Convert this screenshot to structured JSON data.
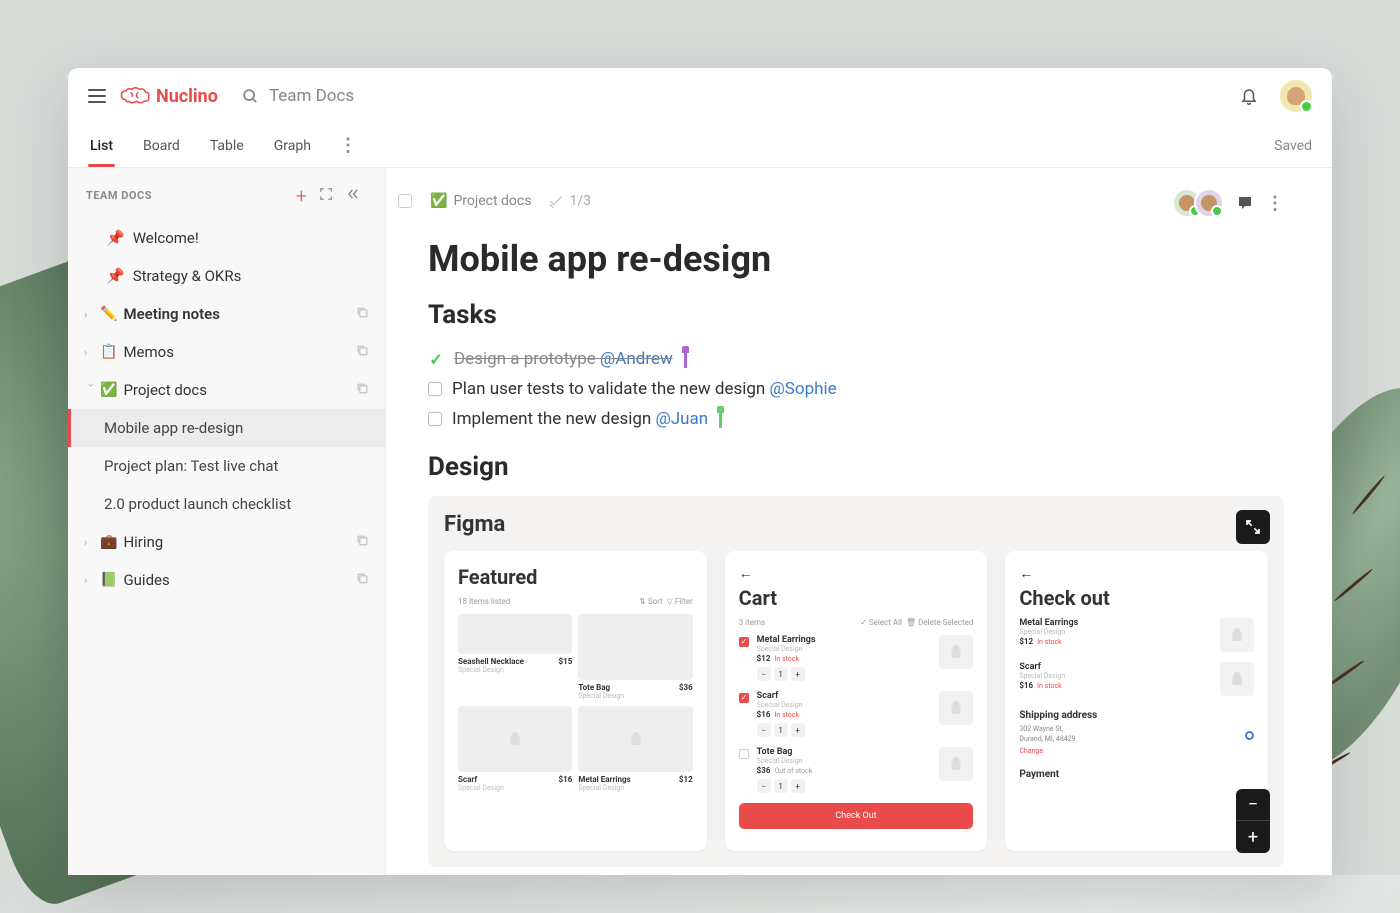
{
  "app_name": "Nuclino",
  "search_placeholder": "Team Docs",
  "saved_label": "Saved",
  "view_tabs": [
    "List",
    "Board",
    "Table",
    "Graph"
  ],
  "sidebar": {
    "title": "TEAM DOCS",
    "pinned": [
      "Welcome!",
      "Strategy & OKRs"
    ],
    "folders": [
      {
        "emoji": "✏️",
        "label": "Meeting notes",
        "bold": true
      },
      {
        "emoji": "📋",
        "label": "Memos"
      },
      {
        "emoji": "✅",
        "label": "Project docs",
        "expanded": true,
        "children": [
          "Mobile app re-design",
          "Project plan: Test live chat",
          "2.0 product launch checklist"
        ]
      },
      {
        "emoji": "💼",
        "label": "Hiring"
      },
      {
        "emoji": "📗",
        "label": "Guides"
      }
    ]
  },
  "document": {
    "breadcrumb_folder": "Project docs",
    "progress": "1/3",
    "title": "Mobile app re-design",
    "sections": {
      "tasks_heading": "Tasks",
      "tasks": [
        {
          "done": true,
          "text": "Design a prototype ",
          "mention": "@Andrew",
          "cursor": "purple"
        },
        {
          "done": false,
          "text": "Plan user tests to validate the new design ",
          "mention": "@Sophie"
        },
        {
          "done": false,
          "text": "Implement the new design ",
          "mention": "@Juan",
          "cursor": "green"
        }
      ],
      "design_heading": "Design"
    }
  },
  "figma": {
    "label": "Figma",
    "screens": {
      "featured": {
        "title": "Featured",
        "count": "18 items listed",
        "sort": "Sort",
        "filter": "Filter",
        "products": [
          {
            "name": "Seashell Necklace",
            "meta": "Special Design",
            "price": "$15"
          },
          {
            "name": "Tote Bag",
            "meta": "Special Design",
            "price": "$36"
          },
          {
            "name": "Scarf",
            "meta": "Special Design",
            "price": "$16"
          },
          {
            "name": "Metal Earrings",
            "meta": "Special Design",
            "price": "$12"
          }
        ]
      },
      "cart": {
        "title": "Cart",
        "count": "3 items",
        "select_all": "Select All",
        "delete": "Delete Selected",
        "items": [
          {
            "name": "Metal Earrings",
            "meta": "Special Design",
            "price": "$12",
            "stock": "In stock",
            "checked": true
          },
          {
            "name": "Scarf",
            "meta": "Special Design",
            "price": "$16",
            "stock": "In stock",
            "checked": true
          },
          {
            "name": "Tote Bag",
            "meta": "Special Design",
            "price": "$36",
            "stock": "Out of stock",
            "checked": false
          }
        ],
        "checkout": "Check Out"
      },
      "checkout": {
        "title": "Check out",
        "items": [
          {
            "name": "Metal Earrings",
            "meta": "Special Design",
            "price": "$12",
            "stock": "In stock"
          },
          {
            "name": "Scarf",
            "meta": "Special Design",
            "price": "$16",
            "stock": "In stock"
          }
        ],
        "shipping_heading": "Shipping address",
        "address_line1": "302 Wayne St,",
        "address_line2": "Durand, MI, 48429",
        "change": "Change",
        "payment_heading": "Payment"
      }
    }
  }
}
